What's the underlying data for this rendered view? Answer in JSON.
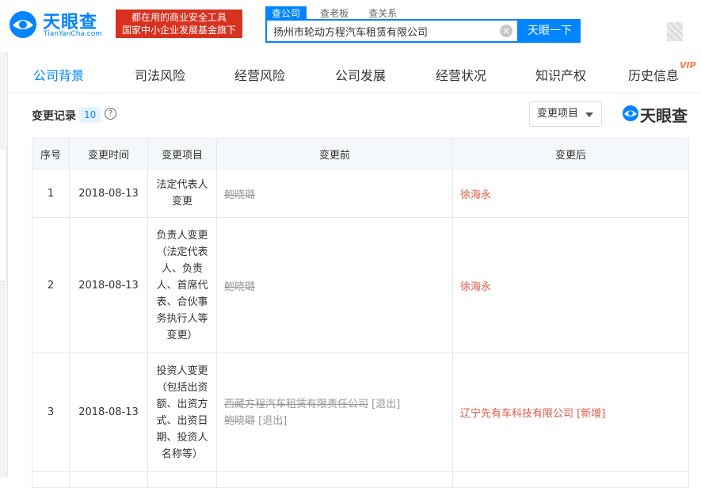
{
  "logo": {
    "name": "天眼查",
    "domain": "TianYanCha.com"
  },
  "slogan": {
    "line1": "都在用的商业安全工具",
    "line2": "国家中小企业发展基金旗下"
  },
  "search": {
    "tabs": [
      "查公司",
      "查老板",
      "查关系"
    ],
    "value": "扬州市轮动方程汽车租赁有限公司",
    "button": "天眼一下"
  },
  "nav": {
    "items": [
      "公司背景",
      "司法风险",
      "经营风险",
      "公司发展",
      "经营状况",
      "知识产权",
      "历史信息"
    ],
    "vip_badge": "VIP"
  },
  "section": {
    "title": "变更记录",
    "count": "10",
    "help": "?",
    "filter_label": "变更项目",
    "watermark": "天眼查"
  },
  "table": {
    "headers": [
      "序号",
      "变更时间",
      "变更项目",
      "变更前",
      "变更后"
    ],
    "rows": [
      {
        "index": "1",
        "date": "2018-08-13",
        "item_lines": [
          "法定代表人",
          "变更"
        ],
        "before": [
          {
            "text": "鲍晓璐",
            "tag": ""
          }
        ],
        "after": "徐海永"
      },
      {
        "index": "2",
        "date": "2018-08-13",
        "item_lines": [
          "负责人变更",
          "（法定代表",
          "人、负责",
          "人、首席代",
          "表、合伙事",
          "务执行人等",
          "变更）"
        ],
        "before": [
          {
            "text": "鲍晓璐",
            "tag": ""
          }
        ],
        "after": "徐海永"
      },
      {
        "index": "3",
        "date": "2018-08-13",
        "item_lines": [
          "投资人变更",
          "（包括出资",
          "额、出资方",
          "式、出资日",
          "期、投资人",
          "名称等）"
        ],
        "before": [
          {
            "text": "西藏方程汽车租赁有限责任公司",
            "tag": "[退出]"
          },
          {
            "text": "鲍晓璐",
            "tag": "[退出]"
          }
        ],
        "after": "辽宁先有车科技有限公司 [新增]"
      }
    ]
  },
  "colors": {
    "brand": "#0084ff",
    "slogan_bg": "#d8311f",
    "after_text": "#e25844",
    "vip": "#ff7a45"
  }
}
